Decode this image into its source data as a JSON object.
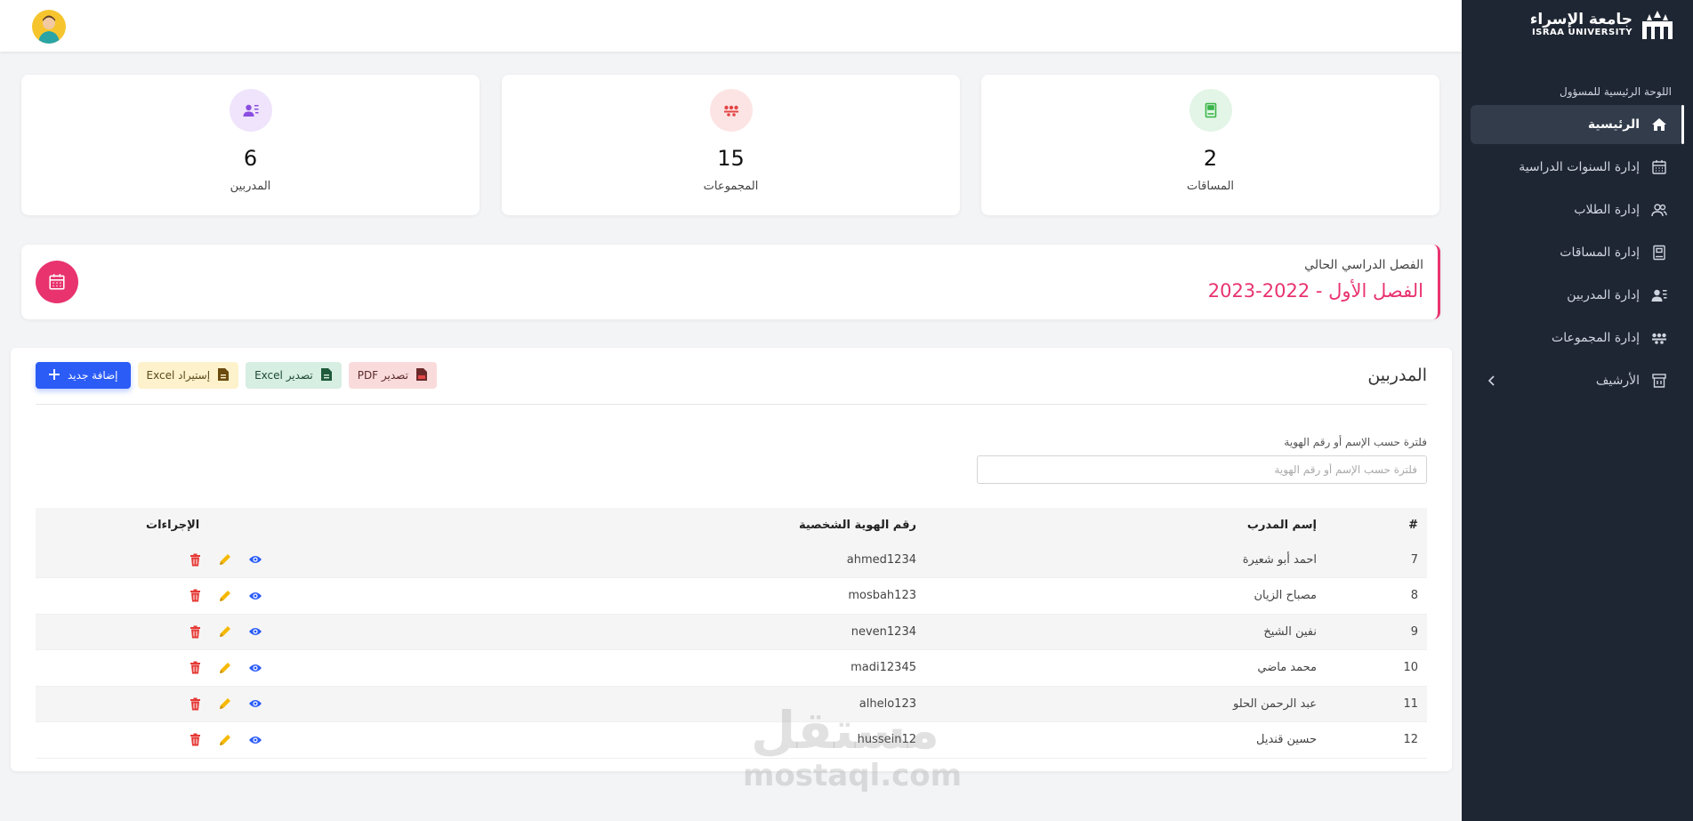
{
  "sidebar": {
    "logo_ar": "جامعة الإسراء",
    "logo_en": "ISRAA UNIVERSITY",
    "section_title": "اللوحة الرئيسية للمسؤول",
    "items": [
      {
        "label": "الرئيسية",
        "icon": "home-icon"
      },
      {
        "label": "إدارة السنوات الدراسية",
        "icon": "calendar-icon"
      },
      {
        "label": "إدارة الطلاب",
        "icon": "users-icon"
      },
      {
        "label": "إدارة المساقات",
        "icon": "book-icon"
      },
      {
        "label": "إدارة المدربين",
        "icon": "user-list-icon"
      },
      {
        "label": "إدارة المجموعات",
        "icon": "groups-icon"
      },
      {
        "label": "الأرشيف",
        "icon": "archive-icon"
      }
    ]
  },
  "stats": [
    {
      "value": "2",
      "label": "المساقات",
      "color": "#e3f5e6",
      "icon_color": "#3ab54a"
    },
    {
      "value": "15",
      "label": "المجموعات",
      "color": "#fde4e4",
      "icon_color": "#e34646"
    },
    {
      "value": "6",
      "label": "المدربين",
      "color": "#efe4fb",
      "icon_color": "#8a4ee0"
    }
  ],
  "semester": {
    "label": "الفصل الدراسي الحالي",
    "value": "الفصل الأول - 2022-2023"
  },
  "trainers": {
    "title": "المدربين",
    "buttons": {
      "pdf": "تصدير PDF",
      "excel_export": "تصدير Excel",
      "excel_import": "إستيراد Excel",
      "add": "إضافة جديد"
    },
    "filter_label": "فلترة حسب الإسم أو رقم الهوية",
    "filter_placeholder": "فلترة حسب الإسم أو رقم الهوية",
    "filter_value": "",
    "columns": {
      "index": "#",
      "name": "إسم المدرب",
      "id": "رقم الهوية الشخصية",
      "actions": "الإجراءات"
    },
    "rows": [
      {
        "index": "7",
        "name": "احمد أبو شعيرة",
        "id": "ahmed1234"
      },
      {
        "index": "8",
        "name": "مصباح الزيان",
        "id": "mosbah123"
      },
      {
        "index": "9",
        "name": "نفين الشيخ",
        "id": "neven1234"
      },
      {
        "index": "10",
        "name": "محمد ماضي",
        "id": "madi12345"
      },
      {
        "index": "11",
        "name": "عبد الرحمن الحلو",
        "id": "alhelo123"
      },
      {
        "index": "12",
        "name": "حسين قنديل",
        "id": "hussein12"
      }
    ]
  },
  "watermark": {
    "ar": "مستقل",
    "en": "mostaql.com"
  },
  "colors": {
    "accent": "#2b5cf6",
    "sidebar": "#1f2633",
    "pink": "#e8336f",
    "edit": "#f6b800",
    "delete": "#e53935"
  }
}
